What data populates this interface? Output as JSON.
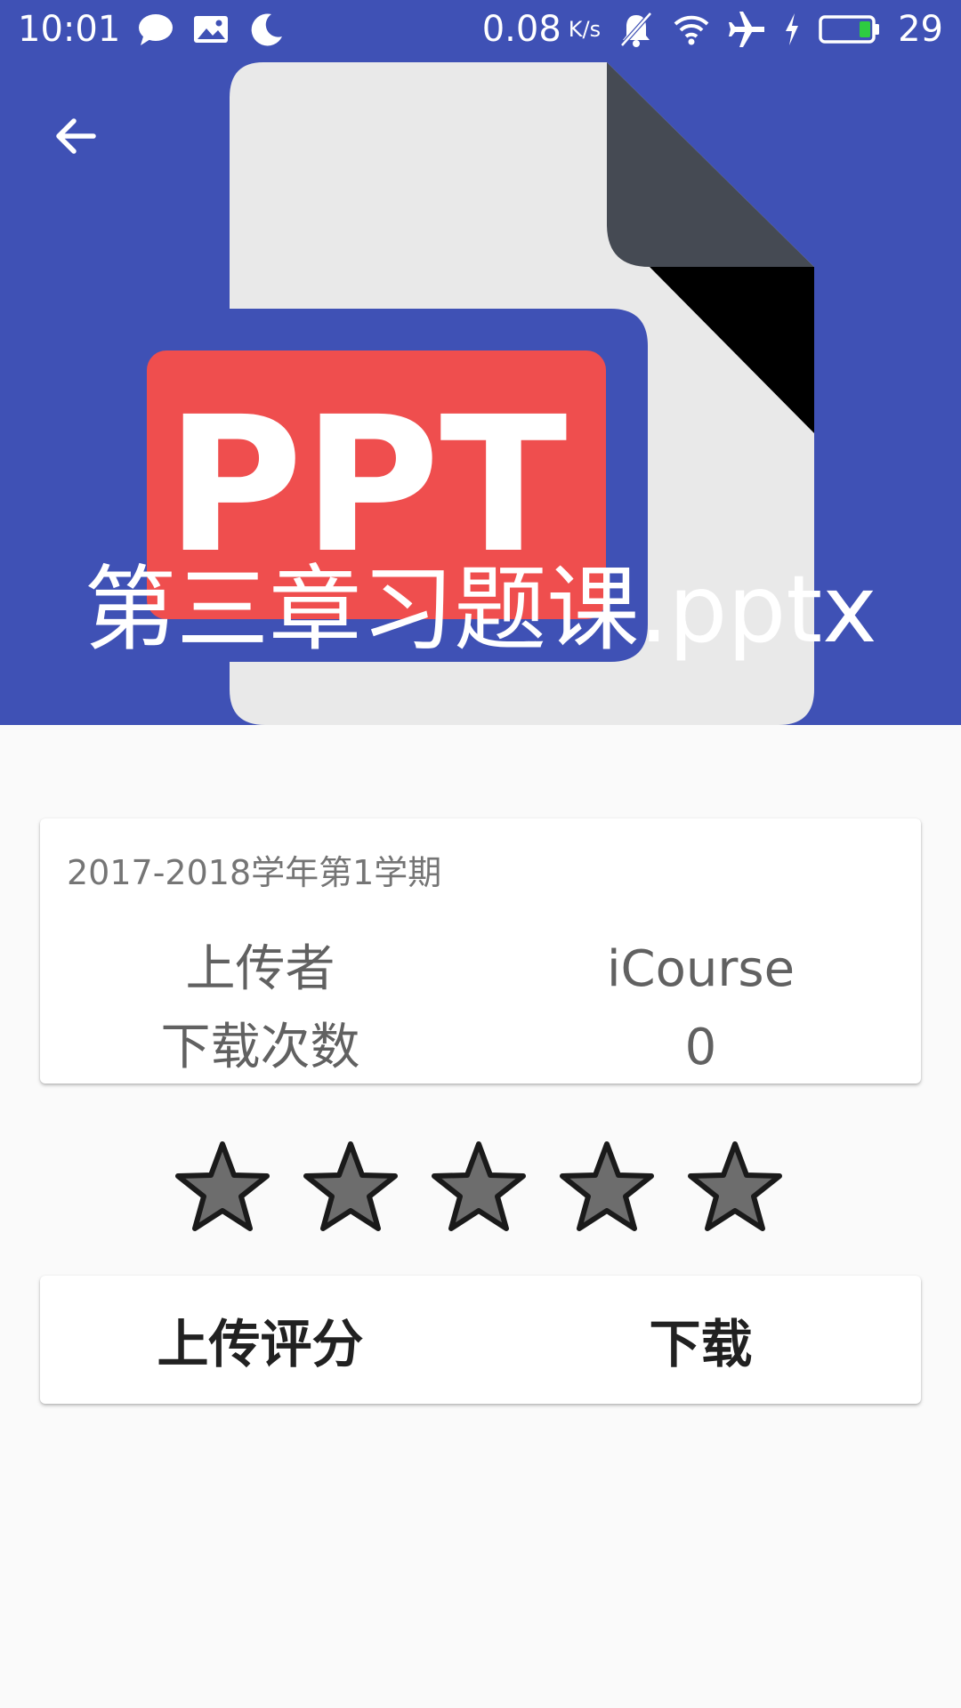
{
  "status_bar": {
    "time": "10:01",
    "net_speed": "0.08",
    "net_unit": "K/s",
    "battery_level": "29",
    "icons": [
      "chat-bubble-icon",
      "image-icon",
      "moon-icon",
      "mute-bell-icon",
      "wifi-icon",
      "airplane-icon",
      "charging-icon",
      "battery-icon"
    ]
  },
  "header": {
    "file_title": "第三章习题课.pptx",
    "file_badge": "PPT",
    "accent_color": "#3f51b5",
    "badge_color": "#ef4e4e"
  },
  "info_card": {
    "term": "2017-2018学年第1学期",
    "uploader_label": "上传者",
    "uploader_value": "iCourse",
    "downloads_label": "下载次数",
    "downloads_value": "0"
  },
  "rating": {
    "max_stars": 5,
    "current_rating": 0
  },
  "actions": {
    "upload_rating_label": "上传评分",
    "download_label": "下载"
  }
}
